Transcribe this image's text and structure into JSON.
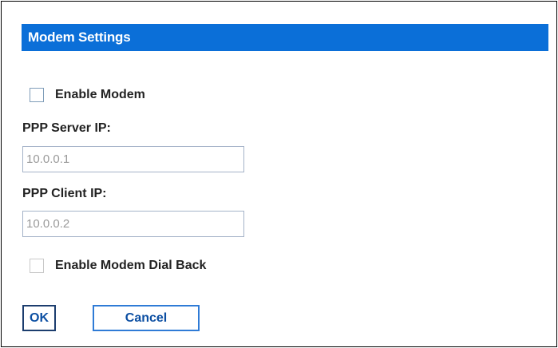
{
  "dialog": {
    "title": "Modem Settings"
  },
  "enable_modem": {
    "label": "Enable Modem",
    "checked": false
  },
  "ppp_server": {
    "label": "PPP Server IP:",
    "value": "10.0.0.1"
  },
  "ppp_client": {
    "label": "PPP Client IP:",
    "value": "10.0.0.2"
  },
  "dial_back": {
    "label": "Enable Modem Dial Back",
    "checked": false,
    "disabled": true
  },
  "buttons": {
    "ok_label": "OK",
    "cancel_label": "Cancel"
  },
  "colors": {
    "title_bar": "#0b6fd8",
    "title_text": "#ffffff",
    "button_text": "#0b4ea2",
    "input_text_disabled": "#9a9a9a"
  }
}
